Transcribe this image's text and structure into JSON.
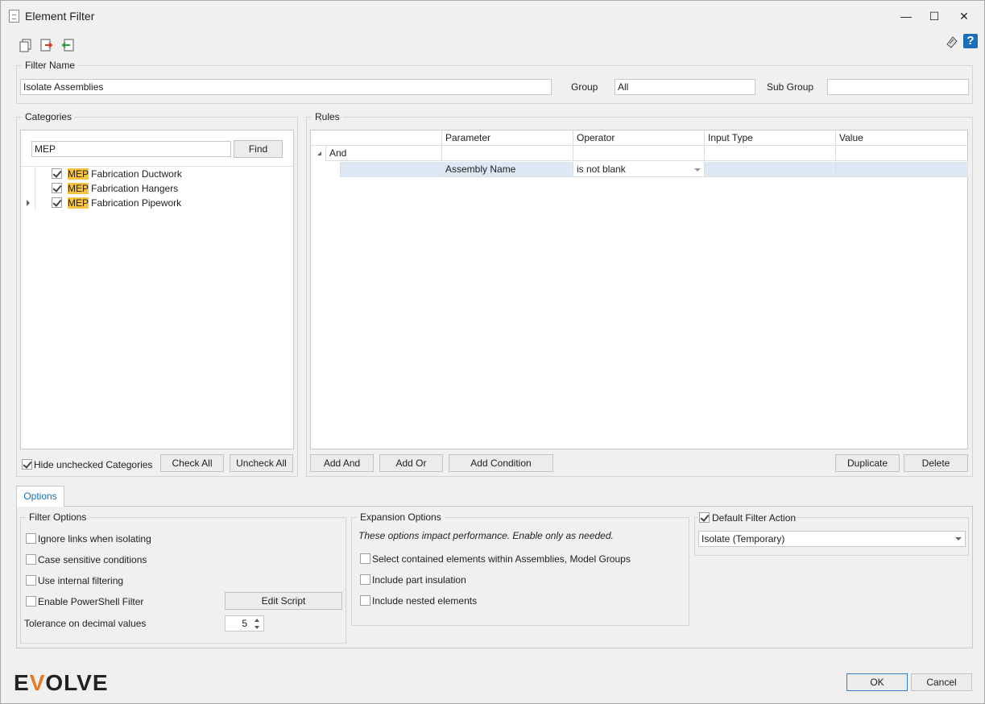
{
  "window": {
    "title": "Element Filter",
    "minimize": "—",
    "maximize": "☐",
    "close": "✕"
  },
  "toolbar": {
    "icons": [
      "new-filter-icon",
      "export-icon",
      "import-icon",
      "settings-icon",
      "help-icon"
    ],
    "help_glyph": "?"
  },
  "filter_name": {
    "label": "Filter Name",
    "value": "Isolate Assemblies"
  },
  "group": {
    "label": "Group",
    "value": "All"
  },
  "sub_group": {
    "label": "Sub Group",
    "value": ""
  },
  "categories": {
    "label": "Categories",
    "search_value": "MEP",
    "find_label": "Find",
    "items": [
      {
        "highlight": "MEP",
        "rest": " Fabrication Ductwork",
        "checked": true
      },
      {
        "highlight": "MEP",
        "rest": " Fabrication Hangers",
        "checked": true
      },
      {
        "highlight": "MEP",
        "rest": " Fabrication Pipework",
        "checked": true
      }
    ],
    "hide_unchecked_label": "Hide unchecked Categories",
    "check_all_label": "Check All",
    "uncheck_all_label": "Uncheck All"
  },
  "rules": {
    "label": "Rules",
    "columns": [
      "Parameter",
      "Operator",
      "Input Type",
      "Value"
    ],
    "group_row": "And",
    "rows": [
      {
        "parameter": "Assembly Name",
        "operator": "is not blank",
        "input_type": "",
        "value": ""
      }
    ],
    "add_and": "Add And",
    "add_or": "Add Or",
    "add_condition": "Add Condition",
    "duplicate": "Duplicate",
    "delete": "Delete"
  },
  "options": {
    "tab_label": "Options",
    "filter_options": {
      "label": "Filter Options",
      "ignore_links": "Ignore links when isolating",
      "case_sensitive": "Case sensitive conditions",
      "internal_filtering": "Use internal filtering",
      "powershell": "Enable PowerShell Filter",
      "edit_script": "Edit Script",
      "tolerance_label": "Tolerance on decimal values",
      "tolerance_value": "5"
    },
    "expansion_options": {
      "label": "Expansion Options",
      "note": "These options impact performance. Enable only as needed.",
      "select_contained": "Select contained elements within Assemblies, Model Groups",
      "part_insulation": "Include part insulation",
      "nested": "Include nested elements"
    },
    "default_action": {
      "label": "Default Filter Action",
      "value": "Isolate (Temporary)"
    }
  },
  "footer": {
    "logo_text_a": "E",
    "logo_text_v": "V",
    "logo_text_b": "OLVE",
    "ok": "OK",
    "cancel": "Cancel"
  },
  "colors": {
    "accent_blue": "#1a6fb8",
    "highlight": "#f7c442",
    "logo_orange": "#e87722",
    "selected_row": "#dde8f5"
  }
}
